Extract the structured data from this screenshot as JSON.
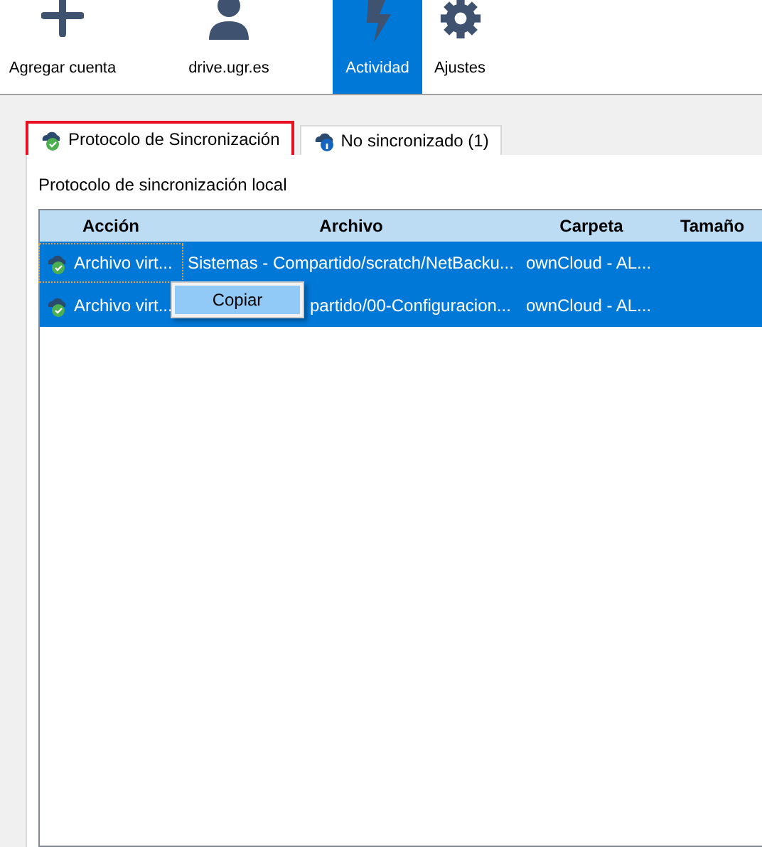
{
  "toolbar": [
    {
      "kind": "add",
      "label": "Agregar cuenta",
      "selected": false
    },
    {
      "kind": "account",
      "label": "drive.ugr.es",
      "selected": false
    },
    {
      "kind": "activity",
      "label": "Actividad",
      "selected": true
    },
    {
      "kind": "settings",
      "label": "Ajustes",
      "selected": false
    }
  ],
  "tabs": [
    {
      "label": "Protocolo de Sincronización",
      "kind": "synced",
      "selected": true
    },
    {
      "label": "No sincronizado (1)",
      "kind": "info",
      "selected": false
    }
  ],
  "section_label": "Protocolo de sincronización local",
  "table": {
    "columns": [
      "Acción",
      "Archivo",
      "Carpeta",
      "Tamaño"
    ],
    "rows": [
      {
        "action": "Archivo virt...",
        "file": "Sistemas - Compartido/scratch/NetBacku...",
        "folder": "ownCloud - AL...",
        "selected": true,
        "focused": true
      },
      {
        "action": "Archivo virt...",
        "file": "partido/00-Configuracion...",
        "folder": "ownCloud - AL...",
        "selected": true,
        "focused": false
      }
    ]
  },
  "context_menu": {
    "items": [
      {
        "label": "Copiar",
        "selected": true
      }
    ]
  }
}
